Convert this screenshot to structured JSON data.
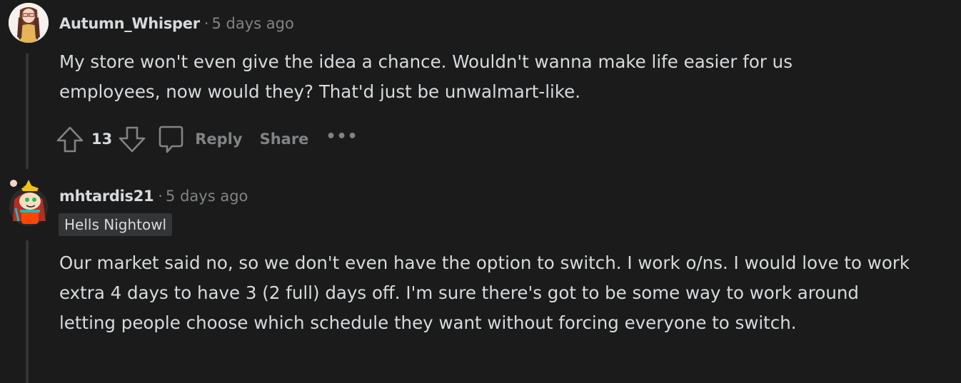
{
  "comments": [
    {
      "username": "Autumn_Whisper",
      "separator": "·",
      "time": "5 days ago",
      "avatar_icon": "user-avatar-anime-girl",
      "body": "My store won't even give the idea a chance. Wouldn't wanna make life easier for us employees, now would they? That'd just be unwalmart-like.",
      "score": "13",
      "actions": {
        "upvote_icon": "upvote-arrow-icon",
        "downvote_icon": "downvote-arrow-icon",
        "comment_icon": "speech-bubble-icon",
        "reply_label": "Reply",
        "share_label": "Share",
        "more_label": "•••"
      }
    },
    {
      "username": "mhtardis21",
      "separator": "·",
      "time": "5 days ago",
      "avatar_icon": "snoo-avatar-red-hair",
      "flair": "Hells Nightowl",
      "body": "Our market said no, so we don't even have the option to switch. I work o/ns. I would love to work extra 4 days to have 3 (2 full) days off. I'm sure there's got to be some way to work around letting people choose which schedule they want without forcing everyone to switch."
    }
  ],
  "colors": {
    "background": "#1b1b1b",
    "text": "#d7dadc",
    "meta": "#818384",
    "thread_line": "#343536",
    "flair_bg": "#343536"
  }
}
